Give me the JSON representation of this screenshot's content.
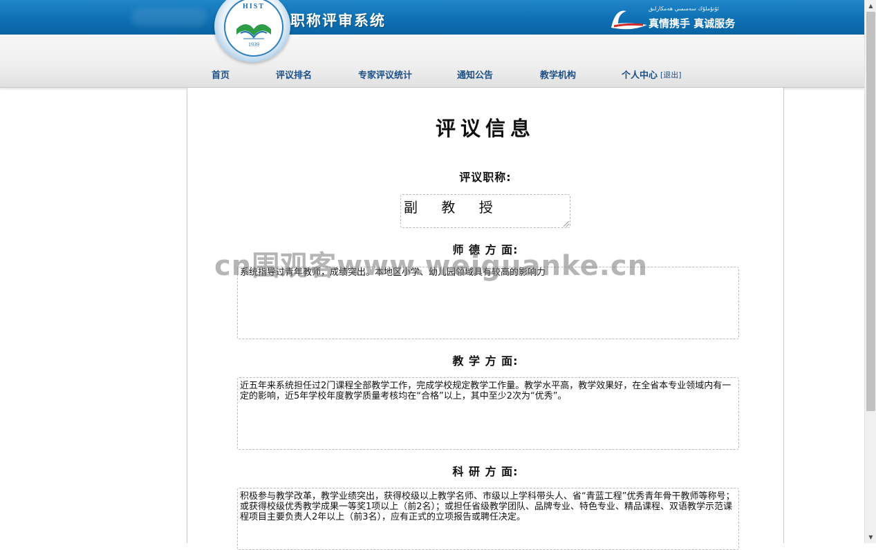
{
  "header": {
    "logo_letters": "HIST",
    "logo_year": "1939",
    "system_title": "职称评审系统",
    "slogan_uyghur": "ئۇنۇملۇك سەمىمىي ھەمكارلىق",
    "slogan_cn": "真情携手 真诚服务",
    "colors": {
      "top_bar": "#0d6fb2",
      "nav_text": "#1b4f86"
    }
  },
  "nav": {
    "items": [
      {
        "label": "首页"
      },
      {
        "label": "评议排名"
      },
      {
        "label": "专家评议统计"
      },
      {
        "label": "通知公告"
      },
      {
        "label": "教学机构"
      },
      {
        "label": "个人中心"
      }
    ],
    "logout_label": "[退出]"
  },
  "main": {
    "page_title": "评议信息",
    "rank_label": "评议职称:",
    "rank_value": "副 教 授",
    "ethics_label": "师 德 方 面:",
    "ethics_text": "系统指导过青年教师，成绩突出。本地区小学、幼儿园领域具有较高的影响力",
    "teaching_label": "教 学 方 面:",
    "teaching_text": "近五年来系统担任过2门课程全部教学工作，完成学校规定教学工作量。教学水平高，教学效果好，在全省本专业领域内有一定的影响，近5年学校年度教学质量考核均在“合格”以上，其中至少2次为“优秀”。",
    "research_label": "科 研 方 面:",
    "research_text": "积极参与教学改革，教学业绩突出，获得校级以上教学名师、市级以上学科带头人、省“青蓝工程”优秀青年骨干教师等称号；或获得校级优秀教学成果一等奖1项以上（前2名）；或担任省级教学团队、品牌专业、特色专业、精品课程、双语教学示范课程项目主要负责人2年以上（前3名），应有正式的立项报告或聘任决定。"
  },
  "watermark": "cn围观客www.weiguanke.cn"
}
